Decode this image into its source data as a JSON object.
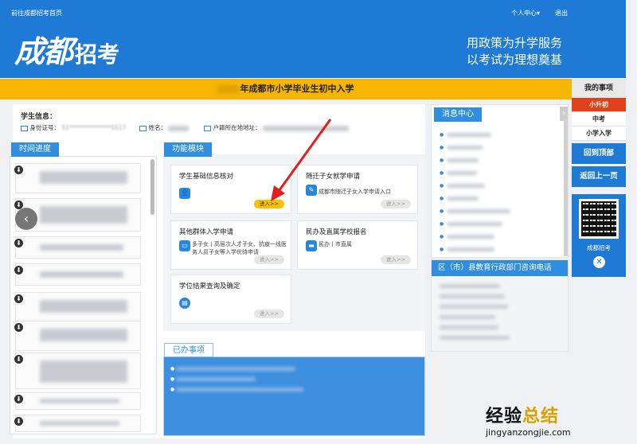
{
  "header": {
    "home_link": "前往成都招考首页",
    "user_menu": "个人中心",
    "user_caret": "▾",
    "logout": "退出",
    "logo_main": "成都",
    "logo_sub": "招考",
    "slogan_1": "用政策为升学服务",
    "slogan_2": "以考试为理想奠基"
  },
  "title_bar": {
    "title": "年成都市小学毕业生初中入学"
  },
  "student": {
    "heading": "学生信息：",
    "id_label": "身份证号：",
    "id_value": "51**************5517",
    "name_label": "姓名：",
    "address_label": "户籍所在地地址："
  },
  "timeline": {
    "heading": "时间进度",
    "prev": "‹",
    "item_icon": "⬇"
  },
  "functions": {
    "heading": "功能模块",
    "cards": [
      {
        "title": "学生基础信息核对",
        "desc": "",
        "button": "进入>>",
        "active": true
      },
      {
        "title": "随迁子女就学申请",
        "desc": "成都市随迁子女入学申请入口",
        "button": "进入>>",
        "active": false
      },
      {
        "title": "其他群体入学申请",
        "desc": "多子女丨高层次人才子女、抗疫一线医务人员子女等入学优待申请",
        "button": "进入>>",
        "active": false
      },
      {
        "title": "民办及直属学校报名",
        "desc": "民办丨市直属",
        "button": "进入>>",
        "active": false
      },
      {
        "title": "学位结果查询及确定",
        "desc": "",
        "button": "进入>>",
        "active": false
      }
    ]
  },
  "done": {
    "heading": "已办事项"
  },
  "messages": {
    "heading": "消息中心",
    "arrow": "›"
  },
  "consult": {
    "heading": "区（市）县教育行政部门咨询电话"
  },
  "side_nav": {
    "heading": "我的事项",
    "items": [
      "小升初",
      "中考",
      "小学入学"
    ],
    "back_top": "回到顶部",
    "back_prev": "返回上一页",
    "qr_caption": "成都招考",
    "close": "✕"
  },
  "watermark": {
    "line1a": "经验",
    "line1b": "总结",
    "line2": "jingyanzongjie.com"
  },
  "colors": {
    "brand_blue": "#1e7ad4",
    "title_yellow": "#f5b500",
    "active_red": "#e2401b"
  }
}
